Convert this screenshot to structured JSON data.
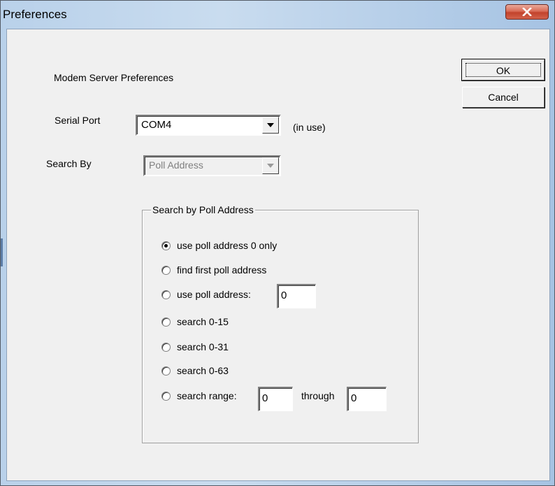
{
  "window": {
    "title": "Preferences"
  },
  "dialog": {
    "heading": "Modem Server Preferences",
    "ok_label": "OK",
    "cancel_label": "Cancel",
    "serial_port": {
      "label": "Serial Port",
      "value": "COM4",
      "status": "(in use)"
    },
    "search_by": {
      "label": "Search By",
      "value": "Poll Address",
      "enabled": false
    },
    "group": {
      "title": "Search by Poll Address",
      "options": [
        {
          "label": "use poll address 0 only",
          "checked": true
        },
        {
          "label": "find first poll address",
          "checked": false
        },
        {
          "label": "use poll address:",
          "checked": false,
          "field_value": "0"
        },
        {
          "label": "search 0-15",
          "checked": false
        },
        {
          "label": "search 0-31",
          "checked": false
        },
        {
          "label": "search 0-63",
          "checked": false
        },
        {
          "label": "search range:",
          "checked": false,
          "from_value": "0",
          "through_label": "through",
          "to_value": "0"
        }
      ]
    }
  },
  "icons": {
    "close": "close-x-icon",
    "dropdown": "chevron-down-icon"
  }
}
